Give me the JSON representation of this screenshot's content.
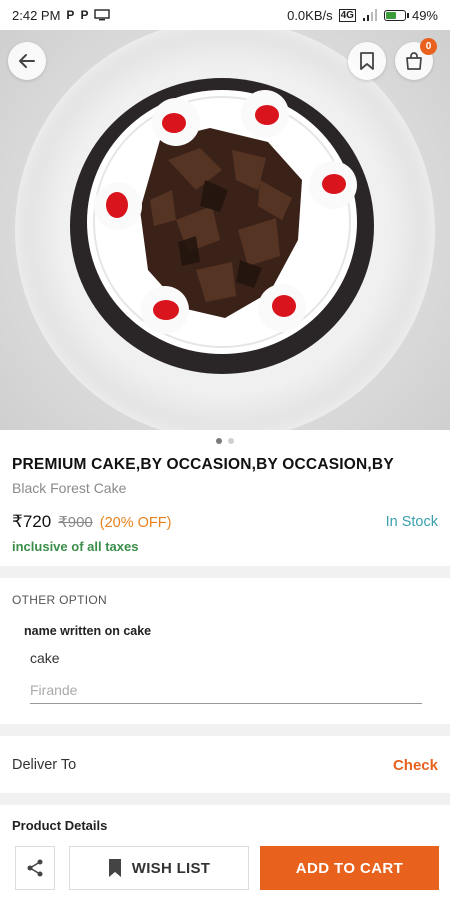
{
  "status_bar": {
    "time": "2:42 PM",
    "app_icons": [
      "P",
      "P"
    ],
    "network_speed": "0.0KB/s",
    "network_type": "4G",
    "battery_percent": "49%",
    "battery_level": 0.49
  },
  "hero": {
    "carousel_count": 2,
    "carousel_active": 0,
    "cart_count": "0"
  },
  "product": {
    "title": "PREMIUM CAKE,BY OCCASION,BY OCCASION,BY",
    "subtitle": "Black Forest Cake",
    "price": "₹720",
    "mrp": "₹900",
    "discount": "(20% OFF)",
    "stock_status": "In Stock",
    "tax_note": "inclusive of all taxes"
  },
  "options": {
    "section_title": "OTHER OPTION",
    "field_label": "name written on cake",
    "field_value": "cake",
    "input_placeholder": "Firande"
  },
  "delivery": {
    "label": "Deliver To",
    "action": "Check"
  },
  "details": {
    "label": "Product Details"
  },
  "actions": {
    "wishlist_label": "WISH LIST",
    "cart_label": "ADD TO CART"
  },
  "colors": {
    "accent": "#e8621e",
    "stock": "#3aa0ad",
    "tax": "#3a8e4a",
    "discount": "#e8821e"
  },
  "icons": [
    "back-arrow-icon",
    "bookmark-icon",
    "shopping-bag-icon",
    "share-icon",
    "wishlist-bookmark-icon"
  ]
}
